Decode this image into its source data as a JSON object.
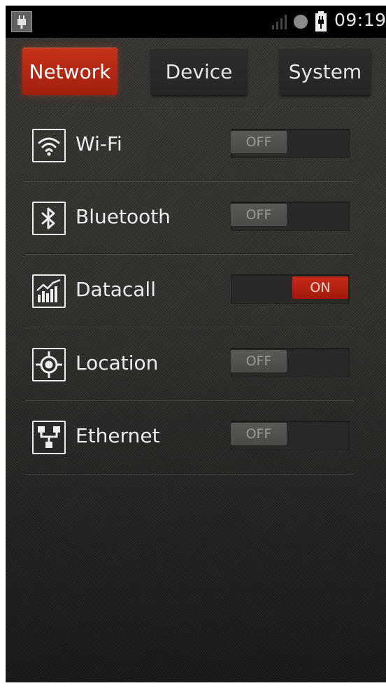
{
  "status_bar": {
    "time": "09:19",
    "icons": [
      "usb-plug-icon",
      "signal-icon",
      "sync-dot-icon",
      "battery-charging-icon"
    ]
  },
  "tabs": [
    {
      "label": "Network",
      "active": true
    },
    {
      "label": "Device",
      "active": false
    },
    {
      "label": "System",
      "active": false
    }
  ],
  "settings": [
    {
      "label": "Wi-Fi",
      "icon": "wifi-icon",
      "state": "OFF"
    },
    {
      "label": "Bluetooth",
      "icon": "bluetooth-icon",
      "state": "OFF"
    },
    {
      "label": "Datacall",
      "icon": "datacall-chart-icon",
      "state": "ON"
    },
    {
      "label": "Location",
      "icon": "location-target-icon",
      "state": "OFF"
    },
    {
      "label": "Ethernet",
      "icon": "ethernet-network-icon",
      "state": "OFF"
    }
  ],
  "colors": {
    "accent_active": "#b3261a",
    "toggle_off": "#55534f",
    "toggle_on": "#b41f10"
  }
}
